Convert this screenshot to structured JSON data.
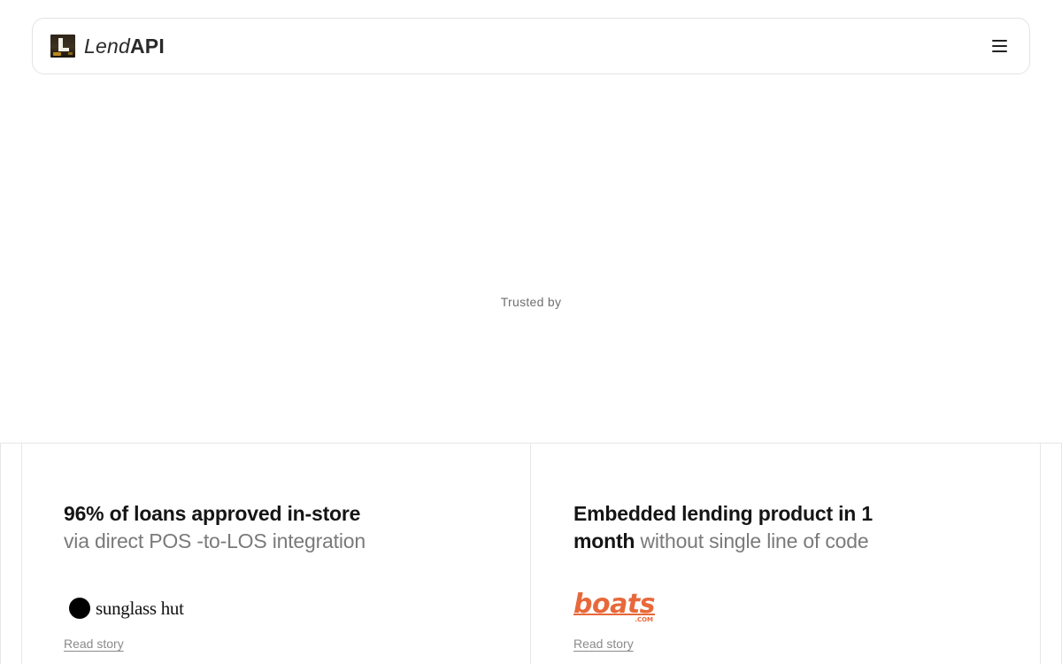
{
  "header": {
    "brand_light": "Lend",
    "brand_bold": "API",
    "menu_icon": "hamburger-menu-icon"
  },
  "trusted": {
    "label": "Trusted by"
  },
  "stories": [
    {
      "title_bold": "96% of loans approved in-store",
      "title_rest": "via direct POS -to-LOS integration",
      "logo_text": "sunglass hut",
      "link": "Read story"
    },
    {
      "title_bold_1": "Embedded lending product in 1",
      "title_bold_2": "month",
      "title_rest": "without single line of code",
      "logo_text": "boats",
      "logo_sub": ".COM",
      "link": "Read story"
    }
  ],
  "colors": {
    "border": "#e6e6e6",
    "muted_text": "#7a7a7a",
    "boats_orange": "#e8683a"
  }
}
